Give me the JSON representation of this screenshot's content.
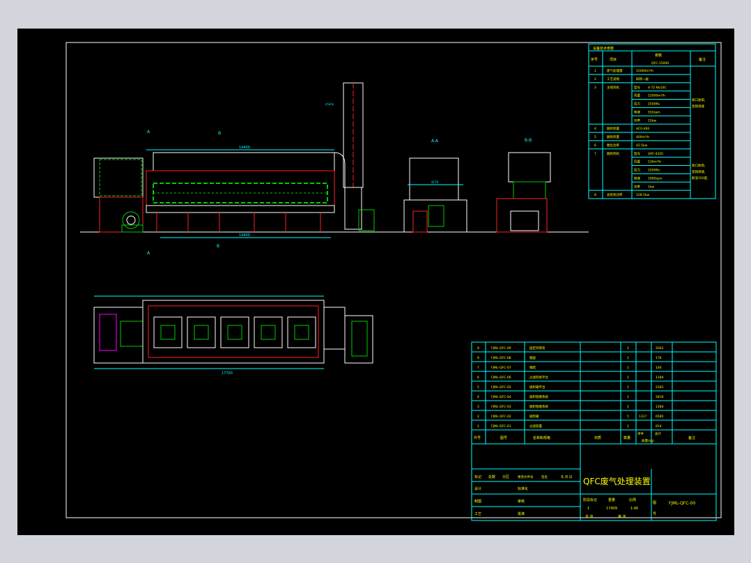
{
  "spec_table": {
    "title": "设备技术参数",
    "headers": {
      "no": "序号",
      "item": "项目",
      "param": "参数",
      "note": "备注"
    },
    "model": "QFC-15000",
    "rows": [
      {
        "no": "1",
        "item": "废气处理量",
        "sub": "",
        "value": "15000m³/h"
      },
      {
        "no": "2",
        "item": "工艺说明",
        "sub": "",
        "value": "四转一脱"
      },
      {
        "no": "3",
        "item": "主排风机",
        "sub": "型号",
        "value": "4-72 No10C"
      },
      {
        "no": "",
        "item": "",
        "sub": "风量",
        "value": "15000m³/h"
      },
      {
        "no": "",
        "item": "",
        "sub": "压力",
        "value": "2500Pa"
      },
      {
        "no": "",
        "item": "",
        "sub": "转速",
        "value": "910rpm"
      },
      {
        "no": "",
        "item": "",
        "sub": "功率",
        "value": "15kw"
      },
      {
        "no": "4",
        "item": "脱附装置",
        "sub": "",
        "value": "AC0-400"
      },
      {
        "no": "5",
        "item": "脱附风量",
        "sub": "",
        "value": "400m³/h"
      },
      {
        "no": "6",
        "item": "催化功率",
        "sub": "",
        "value": "42.5kw"
      },
      {
        "no": "7",
        "item": "脱附风机",
        "sub": "型号",
        "value": "2HF-4320"
      },
      {
        "no": "",
        "item": "",
        "sub": "风量",
        "value": "530m³/h"
      },
      {
        "no": "",
        "item": "",
        "sub": "压力",
        "value": "2500Pa"
      },
      {
        "no": "",
        "item": "",
        "sub": "转速",
        "value": "1900rpm"
      },
      {
        "no": "",
        "item": "",
        "sub": "功率",
        "value": "1kw"
      },
      {
        "no": "8",
        "item": "总装机功率",
        "sub": "",
        "value": "228.5kw"
      }
    ],
    "notes": [
      "喷口防雨,",
      "变频调速",
      "喷口防雨,",
      "变频调速,",
      "耐温350度,"
    ]
  },
  "bom": {
    "headers": {
      "no": "件号",
      "code": "图号",
      "name": "名称和规格",
      "material": "材质",
      "qty": "数量",
      "unit_weight": "单件",
      "total_weight": "总计",
      "weight_label": "质量(kg)",
      "note": "备注"
    },
    "rows": [
      {
        "no": "9",
        "code": "FJML-QFC-09",
        "name": "固定风管架",
        "qty": "1",
        "unit": "",
        "total": "2042"
      },
      {
        "no": "8",
        "code": "FJML-QFC-08",
        "name": "烟囱",
        "qty": "1",
        "unit": "",
        "total": "176"
      },
      {
        "no": "7",
        "code": "FJML-QFC-07",
        "name": "钢结",
        "qty": "1",
        "unit": "",
        "total": "146"
      },
      {
        "no": "6",
        "code": "FJML-QFC-06",
        "name": "过滤检修平台",
        "qty": "1",
        "unit": "",
        "total": "1184"
      },
      {
        "no": "5",
        "code": "FJML-QFC-05",
        "name": "吸附箱平台",
        "qty": "1",
        "unit": "",
        "total": "2345"
      },
      {
        "no": "4",
        "code": "FJML-QFC-04",
        "name": "吸附管路系统",
        "qty": "1",
        "unit": "",
        "total": "2816"
      },
      {
        "no": "3",
        "code": "FJML-QFC-03",
        "name": "脱附管路系统",
        "qty": "1",
        "unit": "",
        "total": "1284"
      },
      {
        "no": "2",
        "code": "FJML-QFC-02",
        "name": "吸附箱",
        "qty": "5",
        "unit": "1317",
        "total": "6585"
      },
      {
        "no": "1",
        "code": "FJML-QFC-01",
        "name": "过滤装置",
        "qty": "1",
        "unit": "",
        "total": "814"
      }
    ]
  },
  "title_block": {
    "drawing_title": "QFC废气处理装置",
    "drawing_no": "FJML-QFC-00",
    "mark_label": "标记",
    "count_label": "处数",
    "zone_label": "分区",
    "change_label": "更改文件号",
    "sign_label": "签名",
    "date_label": "年.月.日",
    "design": "设计",
    "standard": "标准化",
    "draft": "制图",
    "review": "审核",
    "craft": "工艺",
    "approve": "批准",
    "stage_label": "阶段标记",
    "weight_label": "重量",
    "weight": "17409",
    "scale_label": "比例",
    "scale": "1:40",
    "count_value": "1",
    "sheet_total": "共 张",
    "sheet_no": "第 张",
    "side_text": [
      "图",
      "号"
    ]
  },
  "view_labels": {
    "section_a": "A",
    "section_b": "B",
    "view_aa": "A-A",
    "view_bb": "B-B",
    "dim_total_top": "14400",
    "dim_total_bottom": "14400",
    "dim_width": "4170",
    "dim_plan": "17700",
    "chimney_note": "chimn"
  },
  "colors": {
    "background": "#000000",
    "cyan": "#00ffff",
    "red": "#ff2020",
    "green": "#00cc00",
    "white": "#ffffff",
    "yellow": "#ffff00",
    "magenta": "#ff00ff"
  }
}
